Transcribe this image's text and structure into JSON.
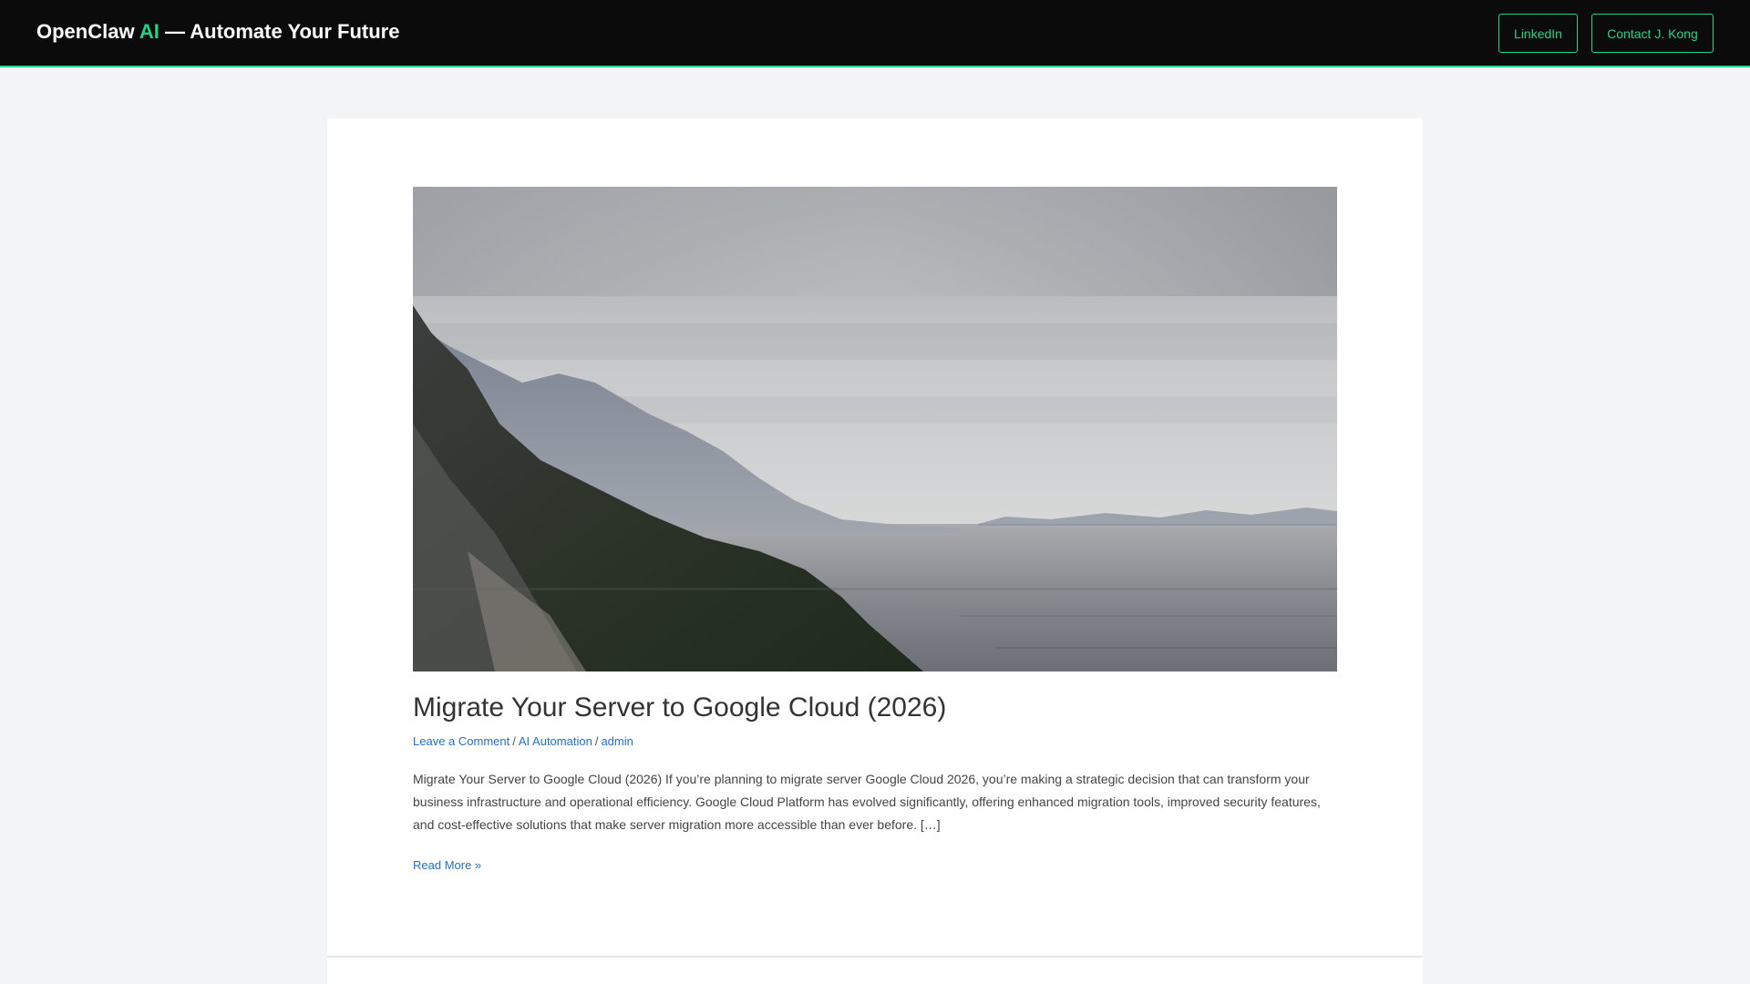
{
  "header": {
    "brand_prefix": "OpenClaw ",
    "brand_accent": "AI",
    "brand_suffix": " — Automate Your Future",
    "linkedin_label": "LinkedIn",
    "contact_label": "Contact J. Kong"
  },
  "post": {
    "title": "Migrate Your Server to Google Cloud (2026)",
    "meta": {
      "comment_link": "Leave a Comment",
      "separator": "/",
      "category": "AI Automation",
      "author": "admin"
    },
    "excerpt": "Migrate Your Server to Google Cloud (2026) If you’re planning to migrate server Google Cloud 2026, you’re making a strategic decision that can transform your business infrastructure and operational efficiency. Google Cloud Platform has evolved significantly, offering enhanced migration tools, improved security features, and cost-effective solutions that make server migration more accessible than ever before. […]",
    "read_more": "Read More »"
  },
  "colors": {
    "header_bg": "#0b0b0b",
    "accent": "#22d38a",
    "link": "#1f6fd1",
    "page_bg": "#f3f4f6",
    "card_bg": "#ffffff"
  },
  "icons": {
    "featured_image": "coastal-mountains-sea-photo"
  }
}
